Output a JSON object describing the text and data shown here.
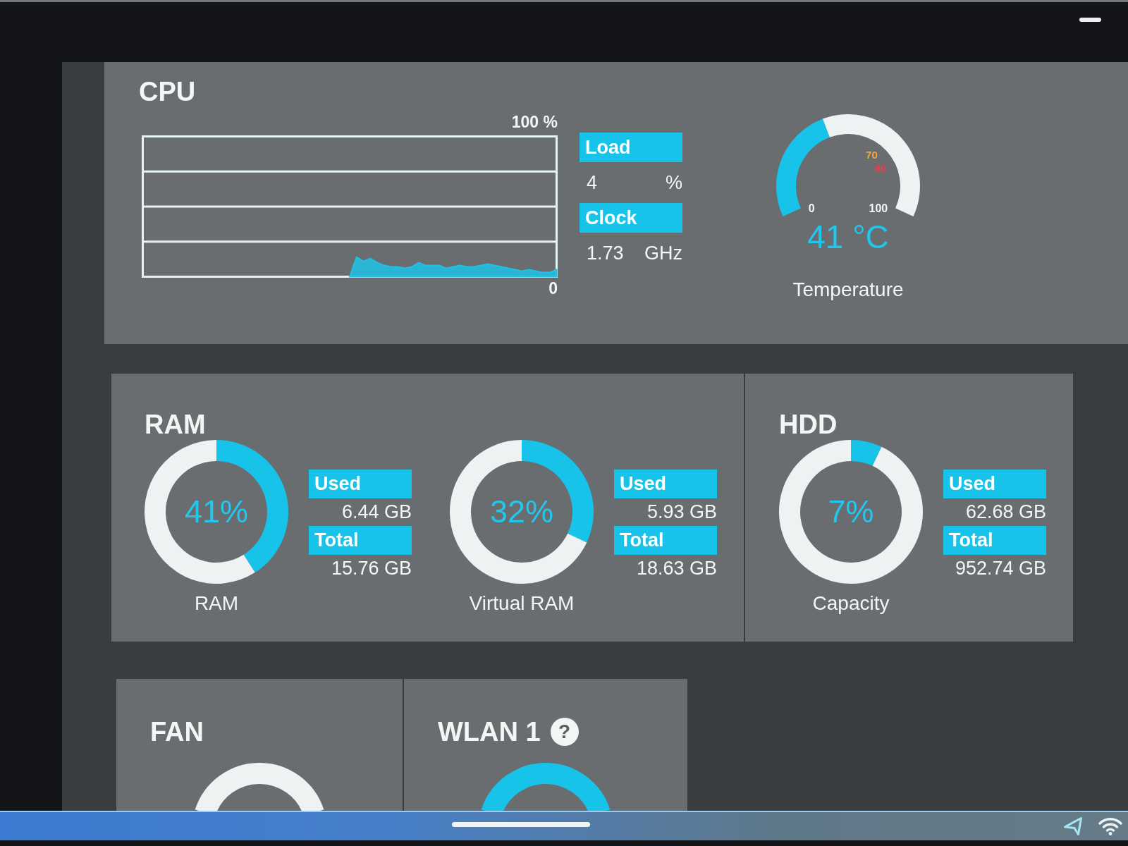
{
  "cpu": {
    "title": "CPU",
    "graph": {
      "max_label": "100 %",
      "min_label": "0"
    },
    "stats": [
      {
        "label": "Load",
        "value": "4",
        "unit": "%"
      },
      {
        "label": "Clock",
        "value": "1.73",
        "unit": "GHz"
      }
    ],
    "temperature": {
      "chart_data": [
        {
          "type": "donut",
          "values": [
            41,
            59
          ],
          "colors": [
            "#17c3e8",
            "#eef2f3"
          ]
        }
      ],
      "scale": [
        "0",
        "100"
      ],
      "marks": [
        {
          "text": "70",
          "color": "#f4a53c"
        },
        {
          "text": "80",
          "color": "#ee3a52"
        }
      ],
      "value": "41 °C",
      "label": "Temperature"
    }
  },
  "memory": {
    "title": "RAM",
    "gauges": [
      {
        "chart_data": [
          {
            "type": "donut",
            "values": [
              41,
              59
            ],
            "colors": [
              "#17c3e8",
              "#eef2f3"
            ]
          }
        ],
        "percent": "41%",
        "label": "RAM",
        "stats": [
          {
            "label": "Used",
            "value": "6.44 GB"
          },
          {
            "label": "Total",
            "value": "15.76 GB"
          }
        ]
      },
      {
        "chart_data": [
          {
            "type": "donut",
            "values": [
              32,
              68
            ],
            "colors": [
              "#17c3e8",
              "#eef2f3"
            ]
          }
        ],
        "percent": "32%",
        "label": "Virtual RAM",
        "stats": [
          {
            "label": "Used",
            "value": "5.93 GB"
          },
          {
            "label": "Total",
            "value": "18.63 GB"
          }
        ]
      }
    ]
  },
  "hdd": {
    "title": "HDD",
    "gauges": [
      {
        "chart_data": [
          {
            "type": "donut",
            "values": [
              7,
              93
            ],
            "colors": [
              "#17c3e8",
              "#eef2f3"
            ]
          }
        ],
        "percent": "7%",
        "label": "Capacity",
        "stats": [
          {
            "label": "Used",
            "value": "62.68 GB"
          },
          {
            "label": "Total",
            "value": "952.74 GB"
          }
        ]
      }
    ]
  },
  "sensors": [
    {
      "title": "FAN",
      "color": "#eef2f3"
    },
    {
      "title": "WLAN 1",
      "help": "?",
      "color": "#17c3e8"
    }
  ]
}
